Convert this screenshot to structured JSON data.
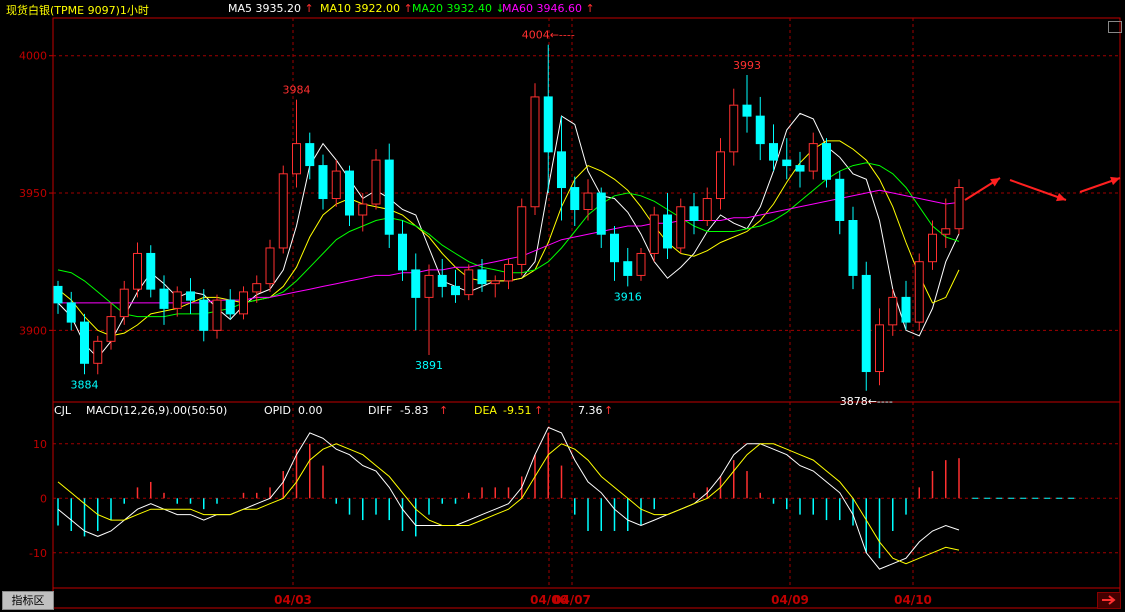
{
  "window": {
    "title": "现货白银(TPME 9097)1小时",
    "tab_label": "指标区"
  },
  "ma_header": [
    {
      "label": "MA5",
      "value": "3935.20",
      "arrow": "↑",
      "color": "#ffffff"
    },
    {
      "label": "MA10",
      "value": "3922.00",
      "arrow": "↑",
      "color": "#ffff00"
    },
    {
      "label": "MA20",
      "value": "3932.40",
      "arrow": "↓",
      "color": "#00ff00"
    },
    {
      "label": "MA60",
      "value": "3946.60",
      "arrow": "↑",
      "color": "#ff00ff"
    }
  ],
  "macd_header": {
    "name": "CJL",
    "params": "MACD(12,26,9).00(50:50)",
    "opid_label": "OPID",
    "opid_value": "0.00",
    "diff_label": "DIFF",
    "diff_value": "-5.83",
    "dea_label": "DEA",
    "dea_value": "-9.51",
    "macd_value": "7.36"
  },
  "colors": {
    "grid": "#a00000",
    "axis": "#c00000",
    "up": "#ff3030",
    "down": "#00ffff",
    "ma5": "#ffffff",
    "ma10": "#ffff00",
    "ma20": "#00ff00",
    "ma60": "#ff00ff",
    "diff": "#ffffff",
    "dea": "#ffff00"
  },
  "chart_data": [
    {
      "type": "candlestick",
      "title": "现货白银(TPME 9097)1小时",
      "price_ticks": [
        "4000",
        "3950",
        "3900"
      ],
      "ylim": [
        3875,
        4005
      ],
      "date_labels": [
        "04/03",
        "04/06",
        "04/07",
        "04/09",
        "04/10"
      ],
      "annotations": [
        {
          "text": "3884",
          "price": 3884,
          "color": "#00ffff"
        },
        {
          "text": "3984",
          "price": 3984,
          "color": "#ff3030"
        },
        {
          "text": "3891",
          "price": 3891,
          "color": "#00ffff"
        },
        {
          "text": "4004←----",
          "price": 4004,
          "color": "#ff3030"
        },
        {
          "text": "3916",
          "price": 3916,
          "color": "#00ffff"
        },
        {
          "text": "3993",
          "price": 3993,
          "color": "#ff3030"
        },
        {
          "text": "3878←----",
          "price": 3878,
          "color": "#ffffff"
        }
      ],
      "series": [
        {
          "name": "MA5",
          "values": [
            3910,
            3905,
            3895,
            3890,
            3896,
            3905,
            3914,
            3921,
            3917,
            3912,
            3914,
            3913,
            3908,
            3904,
            3909,
            3913,
            3915,
            3922,
            3938,
            3960,
            3968,
            3962,
            3955,
            3948,
            3951,
            3948,
            3944,
            3942,
            3930,
            3918,
            3916,
            3914,
            3916,
            3918,
            3918,
            3919,
            3925,
            3952,
            3978,
            3975,
            3958,
            3949,
            3948,
            3943,
            3935,
            3925,
            3919,
            3923,
            3928,
            3936,
            3942,
            3939,
            3937,
            3945,
            3958,
            3973,
            3979,
            3977,
            3967,
            3963,
            3957,
            3955,
            3940,
            3915,
            3900,
            3898,
            3908,
            3925,
            3935.2
          ]
        },
        {
          "name": "MA10",
          "values": [
            3915,
            3911,
            3905,
            3900,
            3898,
            3899,
            3902,
            3906,
            3907,
            3908,
            3910,
            3912,
            3912,
            3911,
            3910,
            3911,
            3912,
            3916,
            3923,
            3934,
            3942,
            3946,
            3948,
            3946,
            3945,
            3944,
            3942,
            3938,
            3934,
            3928,
            3923,
            3919,
            3918,
            3918,
            3918,
            3919,
            3922,
            3932,
            3945,
            3955,
            3960,
            3958,
            3955,
            3951,
            3945,
            3938,
            3932,
            3928,
            3927,
            3929,
            3932,
            3934,
            3936,
            3940,
            3946,
            3954,
            3961,
            3966,
            3969,
            3969,
            3966,
            3962,
            3955,
            3945,
            3932,
            3920,
            3910,
            3912,
            3922.0
          ]
        },
        {
          "name": "MA20",
          "values": [
            3922,
            3921,
            3918,
            3914,
            3910,
            3906,
            3905,
            3905,
            3905,
            3906,
            3906,
            3906,
            3907,
            3908,
            3910,
            3911,
            3912,
            3914,
            3918,
            3923,
            3928,
            3933,
            3936,
            3938,
            3940,
            3941,
            3940,
            3938,
            3935,
            3931,
            3928,
            3925,
            3923,
            3922,
            3921,
            3921,
            3922,
            3925,
            3930,
            3936,
            3942,
            3946,
            3949,
            3950,
            3949,
            3947,
            3944,
            3941,
            3938,
            3936,
            3936,
            3936,
            3937,
            3938,
            3940,
            3943,
            3947,
            3951,
            3955,
            3958,
            3960,
            3961,
            3960,
            3957,
            3952,
            3945,
            3938,
            3934,
            3932.4
          ]
        },
        {
          "name": "MA60",
          "values": [
            3910,
            3910,
            3910,
            3910,
            3910,
            3910,
            3910,
            3910,
            3910,
            3910,
            3910,
            3910,
            3911,
            3911,
            3911,
            3912,
            3912,
            3913,
            3914,
            3915,
            3916,
            3917,
            3918,
            3919,
            3920,
            3920,
            3921,
            3921,
            3922,
            3922,
            3923,
            3923,
            3924,
            3925,
            3926,
            3927,
            3929,
            3931,
            3933,
            3934,
            3935,
            3936,
            3937,
            3938,
            3938,
            3939,
            3939,
            3940,
            3940,
            3940,
            3940,
            3941,
            3941,
            3942,
            3943,
            3944,
            3945,
            3946,
            3947,
            3948,
            3949,
            3950,
            3951,
            3950,
            3949,
            3948,
            3947,
            3946,
            3946.6
          ]
        }
      ],
      "candles": [
        [
          3916,
          3918,
          3906,
          3910
        ],
        [
          3910,
          3914,
          3900,
          3903
        ],
        [
          3903,
          3906,
          3884,
          3888
        ],
        [
          3888,
          3898,
          3884,
          3896
        ],
        [
          3896,
          3910,
          3893,
          3905
        ],
        [
          3905,
          3918,
          3902,
          3915
        ],
        [
          3915,
          3932,
          3912,
          3928
        ],
        [
          3928,
          3931,
          3912,
          3915
        ],
        [
          3915,
          3920,
          3902,
          3908
        ],
        [
          3908,
          3916,
          3905,
          3914
        ],
        [
          3914,
          3919,
          3906,
          3911
        ],
        [
          3911,
          3915,
          3896,
          3900
        ],
        [
          3900,
          3913,
          3897,
          3911
        ],
        [
          3911,
          3915,
          3904,
          3906
        ],
        [
          3906,
          3916,
          3904,
          3914
        ],
        [
          3914,
          3920,
          3910,
          3917
        ],
        [
          3917,
          3933,
          3914,
          3930
        ],
        [
          3930,
          3960,
          3928,
          3957
        ],
        [
          3957,
          3984,
          3952,
          3968
        ],
        [
          3968,
          3972,
          3955,
          3960
        ],
        [
          3960,
          3964,
          3944,
          3948
        ],
        [
          3948,
          3962,
          3945,
          3958
        ],
        [
          3958,
          3960,
          3938,
          3942
        ],
        [
          3942,
          3950,
          3936,
          3946
        ],
        [
          3946,
          3966,
          3944,
          3962
        ],
        [
          3962,
          3968,
          3930,
          3935
        ],
        [
          3935,
          3940,
          3918,
          3922
        ],
        [
          3922,
          3928,
          3900,
          3912
        ],
        [
          3912,
          3924,
          3891,
          3920
        ],
        [
          3920,
          3926,
          3912,
          3916
        ],
        [
          3916,
          3922,
          3910,
          3913
        ],
        [
          3913,
          3924,
          3911,
          3922
        ],
        [
          3922,
          3926,
          3914,
          3917
        ],
        [
          3917,
          3920,
          3912,
          3918
        ],
        [
          3918,
          3926,
          3915,
          3924
        ],
        [
          3924,
          3948,
          3920,
          3945
        ],
        [
          3945,
          3990,
          3942,
          3985
        ],
        [
          3985,
          4004,
          3950,
          3965
        ],
        [
          3965,
          3978,
          3940,
          3952
        ],
        [
          3952,
          3956,
          3938,
          3944
        ],
        [
          3944,
          3955,
          3940,
          3950
        ],
        [
          3950,
          3952,
          3930,
          3935
        ],
        [
          3935,
          3938,
          3918,
          3925
        ],
        [
          3925,
          3930,
          3916,
          3920
        ],
        [
          3920,
          3930,
          3918,
          3928
        ],
        [
          3928,
          3945,
          3925,
          3942
        ],
        [
          3942,
          3950,
          3926,
          3930
        ],
        [
          3930,
          3948,
          3928,
          3945
        ],
        [
          3945,
          3950,
          3935,
          3940
        ],
        [
          3940,
          3952,
          3938,
          3948
        ],
        [
          3948,
          3970,
          3944,
          3965
        ],
        [
          3965,
          3988,
          3960,
          3982
        ],
        [
          3982,
          3993,
          3972,
          3978
        ],
        [
          3978,
          3985,
          3962,
          3968
        ],
        [
          3968,
          3975,
          3958,
          3962
        ],
        [
          3962,
          3970,
          3955,
          3960
        ],
        [
          3960,
          3965,
          3952,
          3958
        ],
        [
          3958,
          3972,
          3955,
          3968
        ],
        [
          3968,
          3970,
          3952,
          3955
        ],
        [
          3955,
          3958,
          3935,
          3940
        ],
        [
          3940,
          3945,
          3915,
          3920
        ],
        [
          3920,
          3925,
          3878,
          3885
        ],
        [
          3885,
          3908,
          3880,
          3902
        ],
        [
          3902,
          3915,
          3898,
          3912
        ],
        [
          3912,
          3918,
          3900,
          3903
        ],
        [
          3903,
          3928,
          3900,
          3925
        ],
        [
          3925,
          3940,
          3922,
          3935
        ],
        [
          3935,
          3948,
          3930,
          3937
        ],
        [
          3937,
          3955,
          3935,
          3952
        ]
      ]
    },
    {
      "type": "macd",
      "title": "MACD(12,26,9)",
      "y_ticks": [
        "10",
        "0",
        "-10"
      ],
      "ylim": [
        -15,
        14
      ],
      "series": [
        {
          "name": "DIFF",
          "values": [
            -2,
            -4,
            -6,
            -7,
            -6,
            -4,
            -2,
            -1,
            -2,
            -3,
            -3,
            -4,
            -3,
            -3,
            -2,
            -1,
            0,
            3,
            8,
            12,
            11,
            9,
            8,
            6,
            5,
            2,
            -2,
            -5,
            -5,
            -5,
            -5,
            -4,
            -3,
            -2,
            -1,
            2,
            8,
            13,
            12,
            7,
            3,
            1,
            -2,
            -4,
            -5,
            -4,
            -3,
            -2,
            -1,
            1,
            4,
            8,
            10,
            10,
            9,
            8,
            6,
            5,
            3,
            1,
            -3,
            -10,
            -13,
            -12,
            -11,
            -8,
            -6,
            -5,
            -5.83
          ]
        },
        {
          "name": "DEA",
          "values": [
            3,
            1,
            -1,
            -3,
            -4,
            -4,
            -3,
            -2,
            -2,
            -2,
            -2,
            -3,
            -3,
            -3,
            -2,
            -2,
            -1,
            0,
            3,
            7,
            9,
            10,
            9,
            8,
            6,
            4,
            1,
            -2,
            -4,
            -5,
            -5,
            -5,
            -4,
            -3,
            -2,
            0,
            4,
            8,
            10,
            9,
            7,
            4,
            2,
            0,
            -2,
            -3,
            -3,
            -2,
            -1,
            0,
            2,
            5,
            8,
            10,
            10,
            9,
            8,
            7,
            5,
            3,
            0,
            -4,
            -8,
            -11,
            -12,
            -11,
            -10,
            -9,
            -9.51
          ]
        },
        {
          "name": "MACD",
          "values": [
            -5,
            -6,
            -7,
            -6,
            -4,
            -1,
            2,
            3,
            1,
            -1,
            -1,
            -2,
            -1,
            0,
            1,
            1,
            2,
            5,
            9,
            10,
            6,
            -1,
            -3,
            -4,
            -3,
            -4,
            -6,
            -7,
            -3,
            -1,
            -1,
            1,
            2,
            2,
            2,
            4,
            8,
            12,
            6,
            -3,
            -6,
            -6,
            -6,
            -6,
            -5,
            -2,
            0,
            0,
            1,
            2,
            4,
            7,
            5,
            1,
            -1,
            -2,
            -3,
            -3,
            -4,
            -4,
            -5,
            -10,
            -11,
            -6,
            -3,
            2,
            5,
            7,
            7.36
          ]
        }
      ]
    }
  ]
}
